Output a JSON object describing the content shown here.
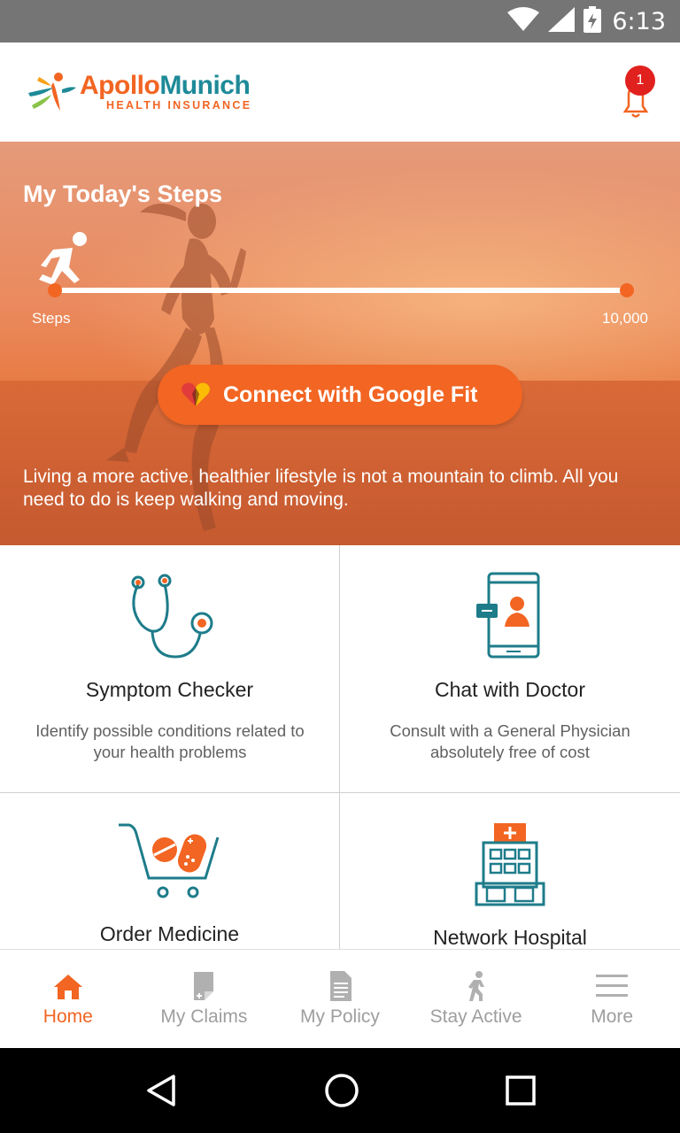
{
  "status_bar": {
    "time": "6:13",
    "icons": [
      "wifi-icon",
      "cell-signal-icon",
      "battery-charging-icon"
    ]
  },
  "header": {
    "brand_part1": "Apollo",
    "brand_part2": "Munich",
    "brand_subtitle": "HEALTH INSURANCE",
    "notification_count": "1"
  },
  "hero": {
    "title": "My Today's Steps",
    "steps_label": "Steps",
    "steps_max": "10,000",
    "steps_progress_fraction": 0,
    "button_label": "Connect with Google Fit",
    "description": "Living a more active, healthier lifestyle is not a mountain to climb. All you need to do is keep walking and moving."
  },
  "cards": [
    {
      "title": "Symptom Checker",
      "desc": "Identify possible conditions related to your health problems",
      "icon": "stethoscope-icon"
    },
    {
      "title": "Chat with Doctor",
      "desc": "Consult with a General Physician absolutely free of cost",
      "icon": "mobile-doctor-icon"
    },
    {
      "title": "Order Medicine",
      "desc": "",
      "icon": "medicine-cart-icon"
    },
    {
      "title": "Network Hospital",
      "desc": "",
      "icon": "hospital-icon"
    }
  ],
  "bottom_nav": [
    {
      "label": "Home",
      "icon": "home-icon",
      "active": true
    },
    {
      "label": "My Claims",
      "icon": "claims-icon",
      "active": false
    },
    {
      "label": "My Policy",
      "icon": "policy-document-icon",
      "active": false
    },
    {
      "label": "Stay Active",
      "icon": "walking-icon",
      "active": false
    },
    {
      "label": "More",
      "icon": "menu-icon",
      "active": false
    }
  ],
  "colors": {
    "accent": "#f26522",
    "teal": "#1e8a98",
    "badge": "#e1211e",
    "inactive": "#9e9e9e"
  }
}
